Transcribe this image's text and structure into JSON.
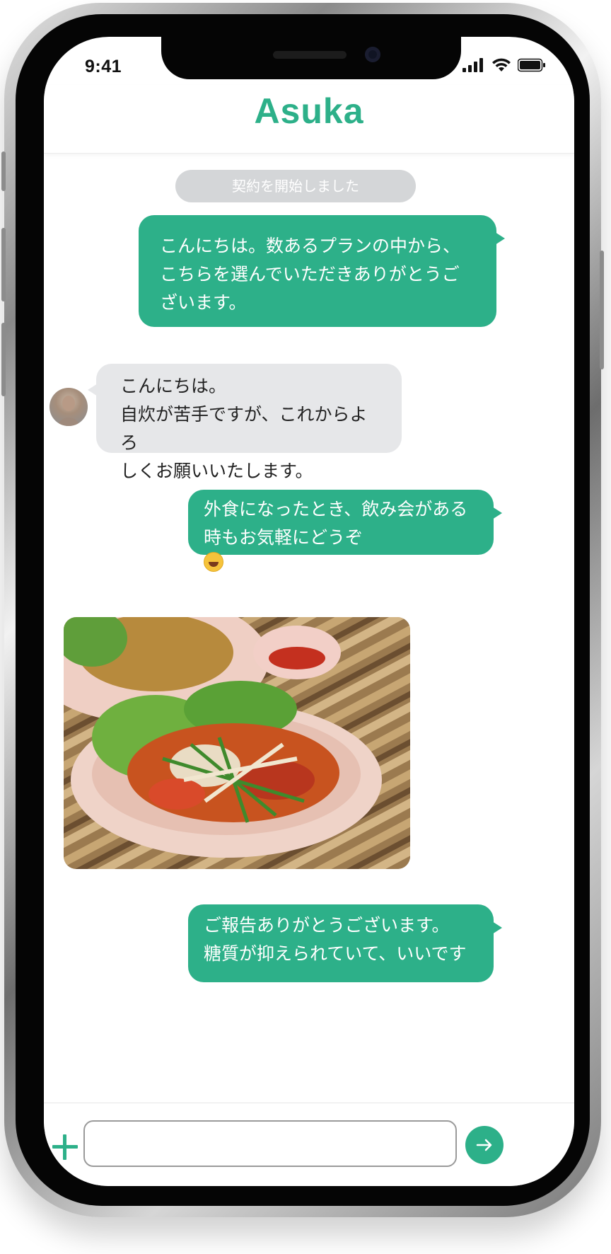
{
  "status_bar": {
    "time": "9:41",
    "icons": [
      "signal-icon",
      "wifi-icon",
      "battery-icon"
    ]
  },
  "header": {
    "title": "Asuka"
  },
  "chat": {
    "system_message": "契約を開始しました",
    "messages": [
      {
        "direction": "outgoing",
        "lines": [
          "こんにちは。数あるプランの中から、",
          "こちらを選んでいただきありがとうご",
          "ざいます。"
        ]
      },
      {
        "direction": "incoming",
        "lines": [
          "こんにちは。",
          "自炊が苦手ですが、これからよろ",
          "しくお願いいたします。"
        ]
      },
      {
        "direction": "outgoing",
        "lines": [
          "外食になったとき、飲み会がある",
          "時もお気軽にどうぞ"
        ],
        "emoji": "grinning-face-icon"
      },
      {
        "direction": "incoming",
        "type": "photo",
        "description_icon": "food-photo"
      },
      {
        "direction": "outgoing",
        "lines": [
          "ご報告ありがとうございます。",
          "糖質が抑えられていて、いいです"
        ]
      }
    ]
  },
  "input_bar": {
    "value": "",
    "placeholder": "",
    "plus_icon": "plus-icon",
    "send_icon": "arrow-right-icon"
  },
  "colors": {
    "accent": "#2db089",
    "incoming_bubble": "#e6e7e9",
    "system_pill": "#d4d6d8"
  }
}
